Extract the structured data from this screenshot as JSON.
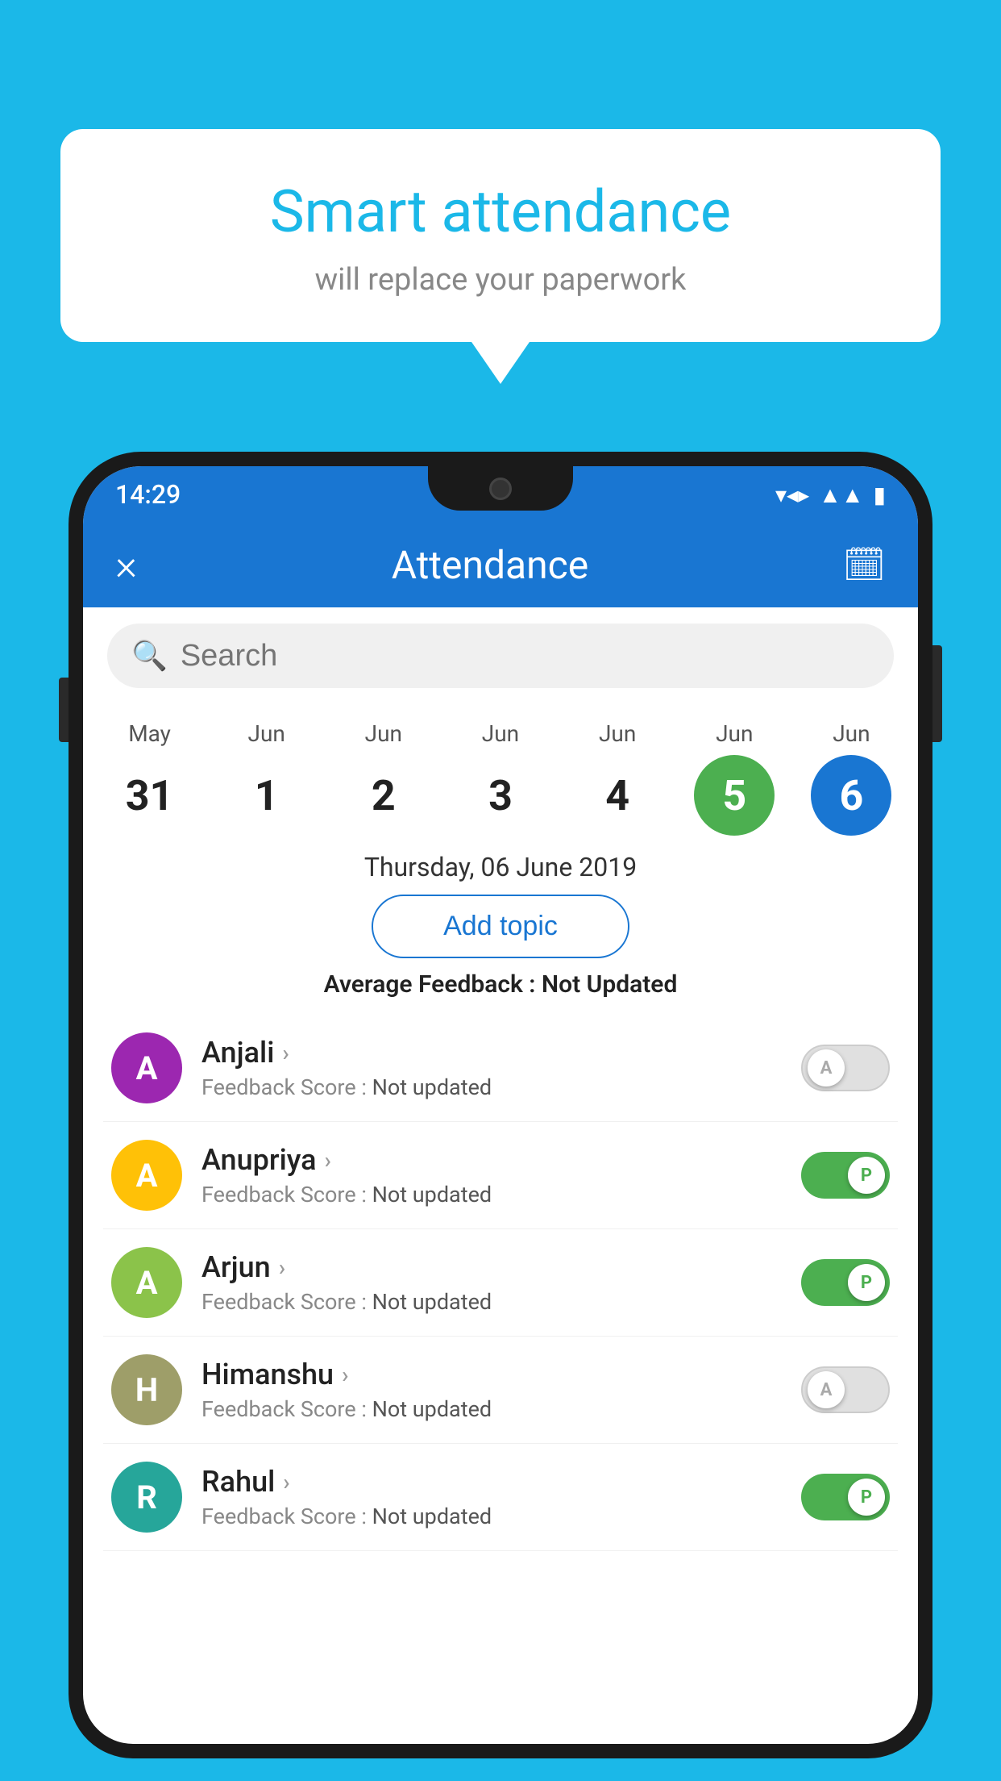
{
  "background_color": "#1BB8E8",
  "bubble": {
    "title": "Smart attendance",
    "subtitle": "will replace your paperwork"
  },
  "status_bar": {
    "time": "14:29",
    "icons": [
      "wifi",
      "signal",
      "battery"
    ]
  },
  "header": {
    "title": "Attendance",
    "close_label": "×",
    "calendar_icon": "📅"
  },
  "search": {
    "placeholder": "Search"
  },
  "calendar": {
    "days": [
      {
        "month": "May",
        "date": "31",
        "style": "normal"
      },
      {
        "month": "Jun",
        "date": "1",
        "style": "normal"
      },
      {
        "month": "Jun",
        "date": "2",
        "style": "normal"
      },
      {
        "month": "Jun",
        "date": "3",
        "style": "normal"
      },
      {
        "month": "Jun",
        "date": "4",
        "style": "normal"
      },
      {
        "month": "Jun",
        "date": "5",
        "style": "green"
      },
      {
        "month": "Jun",
        "date": "6",
        "style": "blue"
      }
    ]
  },
  "selected_date": "Thursday, 06 June 2019",
  "add_topic_label": "Add topic",
  "average_feedback": {
    "label": "Average Feedback :",
    "value": "Not Updated"
  },
  "students": [
    {
      "name": "Anjali",
      "avatar_letter": "A",
      "avatar_color": "avatar-purple",
      "feedback_label": "Feedback Score :",
      "feedback_value": "Not updated",
      "toggle_state": "off",
      "toggle_letter": "A"
    },
    {
      "name": "Anupriya",
      "avatar_letter": "A",
      "avatar_color": "avatar-yellow",
      "feedback_label": "Feedback Score :",
      "feedback_value": "Not updated",
      "toggle_state": "on",
      "toggle_letter": "P"
    },
    {
      "name": "Arjun",
      "avatar_letter": "A",
      "avatar_color": "avatar-green",
      "feedback_label": "Feedback Score :",
      "feedback_value": "Not updated",
      "toggle_state": "on",
      "toggle_letter": "P"
    },
    {
      "name": "Himanshu",
      "avatar_letter": "H",
      "avatar_color": "avatar-olive",
      "feedback_label": "Feedback Score :",
      "feedback_value": "Not updated",
      "toggle_state": "off",
      "toggle_letter": "A"
    },
    {
      "name": "Rahul",
      "avatar_letter": "R",
      "avatar_color": "avatar-teal",
      "feedback_label": "Feedback Score :",
      "feedback_value": "Not updated",
      "toggle_state": "on",
      "toggle_letter": "P"
    }
  ]
}
